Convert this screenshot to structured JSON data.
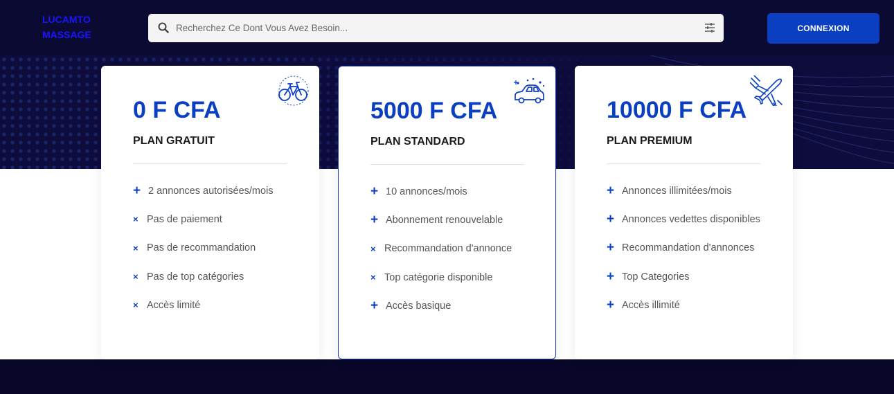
{
  "header": {
    "logo_line1": "LUCAMTO",
    "logo_line2": "MASSAGE",
    "search_placeholder": "Recherchez Ce Dont Vous Avez Besoin...",
    "login_label": "CONNEXION"
  },
  "colors": {
    "accent": "#0a3fc2",
    "logo": "#1a14ff",
    "header_bg": "#0b0a33"
  },
  "plans": [
    {
      "price": "0 F CFA",
      "name": "PLAN GRATUIT",
      "icon": "bicycle-icon",
      "features": [
        {
          "mark": "+",
          "text": "2 annonces autorisées/mois"
        },
        {
          "mark": "×",
          "text": "Pas de paiement"
        },
        {
          "mark": "×",
          "text": "Pas de recommandation"
        },
        {
          "mark": "×",
          "text": "Pas de top catégories"
        },
        {
          "mark": "×",
          "text": "Accès limité"
        }
      ]
    },
    {
      "price": "5000 F CFA",
      "name": "PLAN STANDARD",
      "icon": "car-icon",
      "features": [
        {
          "mark": "+",
          "text": "10 annonces/mois"
        },
        {
          "mark": "+",
          "text": "Abonnement renouvelable"
        },
        {
          "mark": "×",
          "text": "Recommandation d'annonce"
        },
        {
          "mark": "×",
          "text": "Top catégorie disponible"
        },
        {
          "mark": "+",
          "text": "Accès basique"
        }
      ]
    },
    {
      "price": "10000 F CFA",
      "name": "PLAN PREMIUM",
      "icon": "airplane-icon",
      "features": [
        {
          "mark": "+",
          "text": "Annonces illimitées/mois"
        },
        {
          "mark": "+",
          "text": "Annonces vedettes disponibles"
        },
        {
          "mark": "+",
          "text": "Recommandation d'annonces"
        },
        {
          "mark": "+",
          "text": "Top Categories"
        },
        {
          "mark": "+",
          "text": "Accès illimité"
        }
      ]
    }
  ]
}
